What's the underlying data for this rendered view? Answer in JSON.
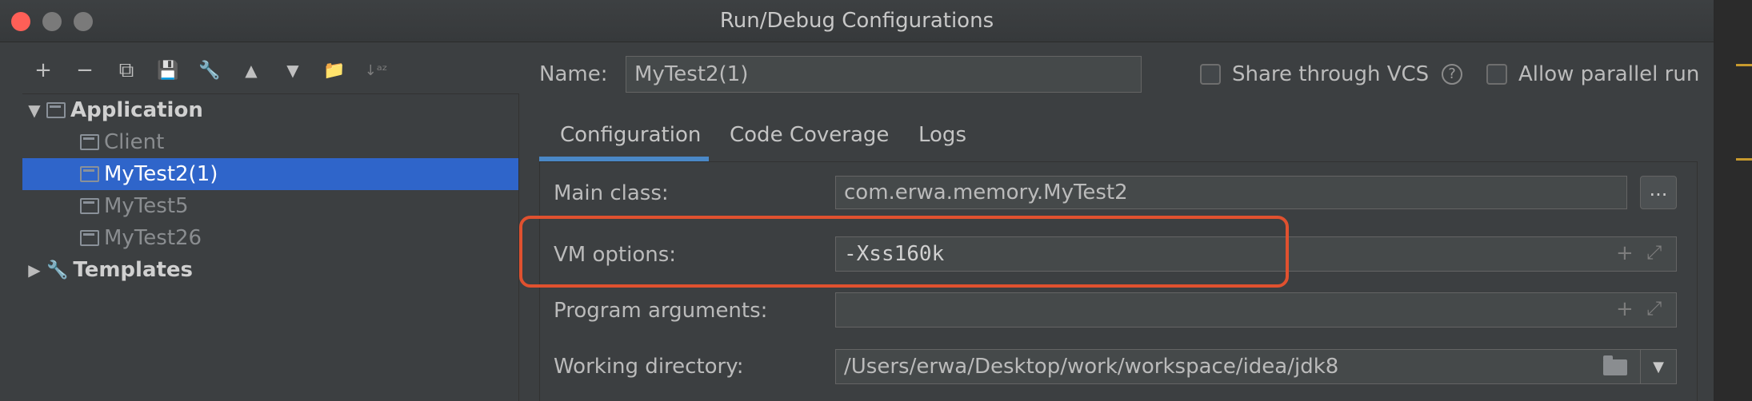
{
  "window": {
    "title": "Run/Debug Configurations"
  },
  "toolbar": {
    "add": "+",
    "remove": "−",
    "copy": "⧉",
    "save": "💾",
    "edit_defaults": "🔧",
    "move_up": "▲",
    "move_down": "▼",
    "new_folder": "📁",
    "sort": "↓ᵃᶻ"
  },
  "tree": {
    "application": {
      "label": "Application",
      "expanded_glyph": "▼"
    },
    "items": [
      {
        "label": "Client"
      },
      {
        "label": "MyTest2(1)"
      },
      {
        "label": "MyTest5"
      },
      {
        "label": "MyTest26"
      }
    ],
    "templates": {
      "label": "Templates",
      "collapsed_glyph": "▶"
    }
  },
  "header": {
    "name_label": "Name:",
    "name_value": "MyTest2(1)",
    "share_vcs_label": "Share through VCS",
    "help_glyph": "?",
    "parallel_label": "Allow parallel run"
  },
  "tabs": [
    {
      "label": "Configuration"
    },
    {
      "label": "Code Coverage"
    },
    {
      "label": "Logs"
    }
  ],
  "form": {
    "main_class_label": "Main class:",
    "main_class_value": "com.erwa.memory.MyTest2",
    "browse_button": "...",
    "vm_options_label": "VM options:",
    "vm_options_value": "-Xss160k",
    "program_args_label": "Program arguments:",
    "program_args_value": "",
    "working_dir_label": "Working directory:",
    "working_dir_value": "/Users/erwa/Desktop/work/workspace/idea/jdk8",
    "expand_glyph": "+",
    "fullscreen_glyph": "⤢",
    "dropdown_glyph": "▼"
  },
  "colors": {
    "selection": "#2f65ca",
    "highlight_box": "#e0512f",
    "tab_underline": "#4a88c7",
    "close_button": "#ff5f57"
  }
}
